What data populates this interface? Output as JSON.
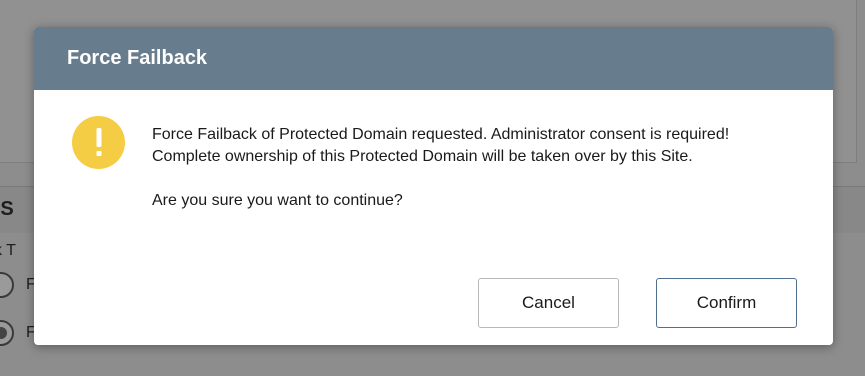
{
  "background": {
    "section_title": "r S",
    "field_label": "ck T",
    "radio_options": [
      "F",
      "F"
    ]
  },
  "dialog": {
    "title": "Force Failback",
    "icon": "warning-icon",
    "message_line1": "Force Failback of Protected Domain requested. Administrator consent is required!",
    "message_line2": "Complete ownership of this Protected Domain will be taken over by this Site.",
    "question": "Are you sure you want to continue?",
    "cancel_label": "Cancel",
    "confirm_label": "Confirm"
  },
  "colors": {
    "header": "#677c8c",
    "warning": "#f5cd45",
    "confirm_border": "#4f6f8f",
    "overlay": "#8d8d8d"
  }
}
